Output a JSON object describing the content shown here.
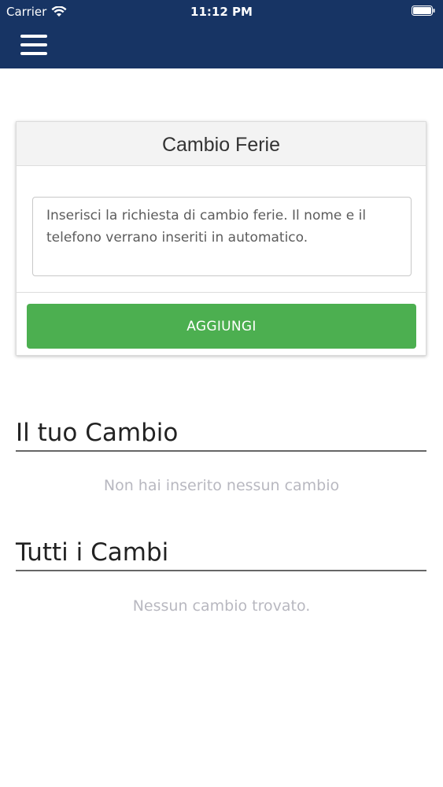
{
  "status_bar": {
    "carrier": "Carrier",
    "time": "11:12 PM",
    "wifi_icon": "wifi-icon",
    "battery_icon": "battery-icon"
  },
  "navbar": {
    "menu_icon": "hamburger-menu-icon",
    "background_color": "#173464"
  },
  "form": {
    "title": "Cambio Ferie",
    "textarea_value": "",
    "textarea_placeholder": "Inserisci la richiesta di cambio ferie. Il nome e il telefono verrano inseriti in automatico.",
    "add_button_label": "AGGIUNGI",
    "add_button_color": "#4caf50"
  },
  "my_change": {
    "title": "Il tuo Cambio",
    "empty_text": "Non hai inserito nessun cambio"
  },
  "all_changes": {
    "title": "Tutti i Cambi",
    "empty_text": "Nessun cambio trovato."
  }
}
